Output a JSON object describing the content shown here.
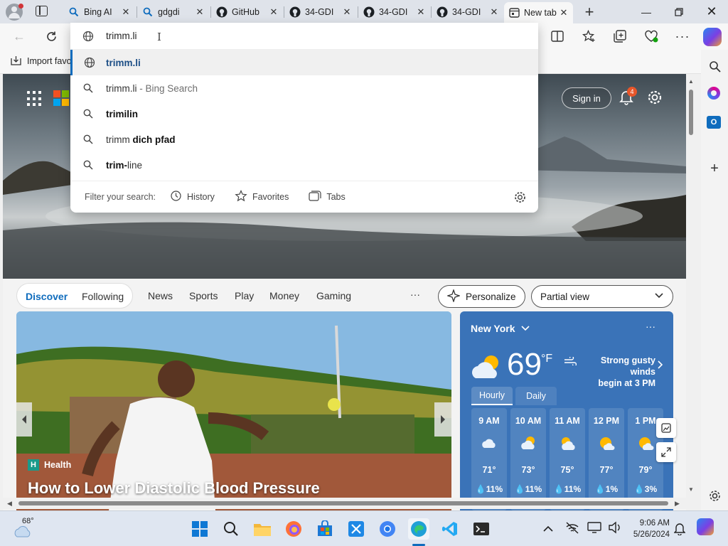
{
  "tabs": [
    {
      "title": "Bing AI",
      "icon": "search-icon"
    },
    {
      "title": "gdgdi",
      "icon": "search-icon"
    },
    {
      "title": "GitHub",
      "icon": "github-icon"
    },
    {
      "title": "34-GDI",
      "icon": "github-icon"
    },
    {
      "title": "34-GDI",
      "icon": "github-icon"
    },
    {
      "title": "34-GDI",
      "icon": "github-icon"
    },
    {
      "title": "New tab",
      "icon": "newtab-icon",
      "active": true
    }
  ],
  "address": {
    "value": "trimm.li"
  },
  "favorites_bar": {
    "import_label": "Import favo"
  },
  "suggestions": [
    {
      "plain": "",
      "bold": "trimm.li",
      "suffix": "",
      "icon": "globe-icon",
      "highlighted": true
    },
    {
      "plain": "trimm.li",
      "bold": "",
      "suffix": " - Bing Search",
      "icon": "search-icon"
    },
    {
      "plain": "",
      "bold": "trimilin",
      "suffix": "",
      "icon": "search-icon"
    },
    {
      "plain": "trimm ",
      "bold": "dich pfad",
      "suffix": "",
      "icon": "search-icon"
    },
    {
      "plain": "",
      "bold": "trim-",
      "suffix": "line",
      "icon": "search-icon"
    }
  ],
  "filter": {
    "label": "Filter your search:",
    "history": "History",
    "favorites": "Favorites",
    "tabs": "Tabs"
  },
  "newtab": {
    "sign_in": "Sign in",
    "notification_count": "4"
  },
  "feed": {
    "tabs": [
      "Discover",
      "Following"
    ],
    "nav": [
      "News",
      "Sports",
      "Play",
      "Money",
      "Gaming"
    ],
    "more": "···",
    "personalize": "Personalize",
    "view": "Partial view"
  },
  "article": {
    "category": "Health",
    "title": "How to Lower Diastolic Blood Pressure"
  },
  "weather": {
    "location": "New York",
    "temp": "69",
    "unit": "°F",
    "alert_line1": "Strong gusty winds",
    "alert_line2": "begin at 3 PM",
    "tab_hourly": "Hourly",
    "tab_daily": "Daily",
    "hours": [
      {
        "time": "9 AM",
        "temp": "71°",
        "precip": "11%",
        "icon": "cloud-icon"
      },
      {
        "time": "10 AM",
        "temp": "73°",
        "precip": "11%",
        "icon": "partly-cloudy-icon"
      },
      {
        "time": "11 AM",
        "temp": "75°",
        "precip": "11%",
        "icon": "partly-cloudy-icon"
      },
      {
        "time": "12 PM",
        "temp": "77°",
        "precip": "1%",
        "icon": "partly-sunny-icon"
      },
      {
        "time": "1 PM",
        "temp": "79°",
        "precip": "3%",
        "icon": "partly-sunny-icon"
      }
    ]
  },
  "taskbar": {
    "weather_temp": "68°",
    "time": "9:06 AM",
    "date": "5/26/2024"
  },
  "colors": {
    "accent": "#0f6cbd",
    "weather_bg": "#3a73b8",
    "tab_strip": "#dfe3ea"
  }
}
